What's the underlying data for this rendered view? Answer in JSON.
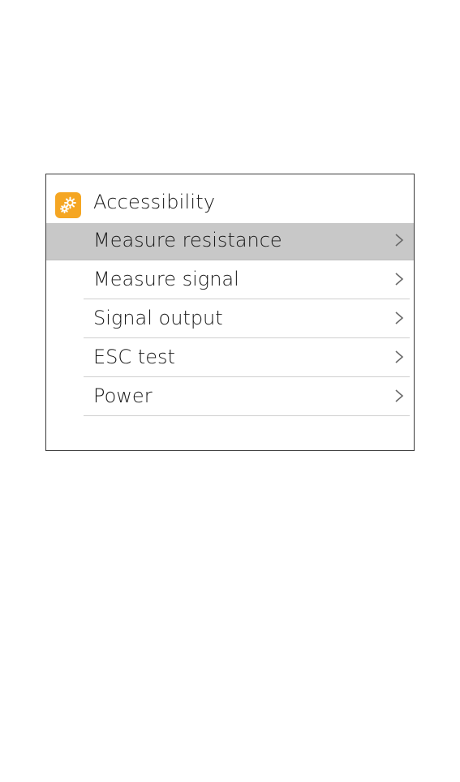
{
  "header": {
    "title": "Accessibility",
    "icon": "gears-icon",
    "icon_color": "#f5a623"
  },
  "menu": {
    "items": [
      {
        "label": "Measure resistance",
        "selected": true
      },
      {
        "label": "Measure signal",
        "selected": false
      },
      {
        "label": "Signal output",
        "selected": false
      },
      {
        "label": "ESC test",
        "selected": false
      },
      {
        "label": "Power",
        "selected": false
      }
    ]
  },
  "colors": {
    "selected_background": "#c8c8c8",
    "divider": "#cfcfcf",
    "panel_border": "#3a3a3a"
  }
}
